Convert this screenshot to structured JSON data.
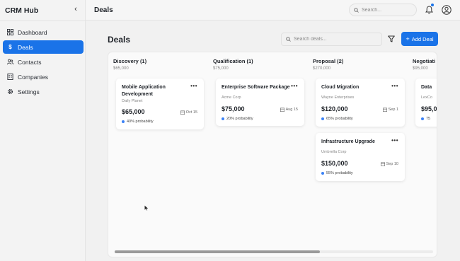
{
  "sidebar": {
    "brand": "CRM Hub",
    "collapse_icon": "‹",
    "items": [
      {
        "label": "Dashboard",
        "icon": "dashboard-icon",
        "active": false
      },
      {
        "label": "Deals",
        "icon": "dollar-icon",
        "active": true
      },
      {
        "label": "Contacts",
        "icon": "contacts-icon",
        "active": false
      },
      {
        "label": "Companies",
        "icon": "building-icon",
        "active": false
      },
      {
        "label": "Settings",
        "icon": "gear-icon",
        "active": false
      }
    ]
  },
  "topbar": {
    "title": "Deals",
    "search_placeholder": "Search..."
  },
  "main": {
    "heading": "Deals",
    "search_placeholder": "Search deals...",
    "add_button": "Add Deal"
  },
  "columns": [
    {
      "title": "Discovery (1)",
      "total": "$65,000"
    },
    {
      "title": "Qualification (1)",
      "total": "$75,000"
    },
    {
      "title": "Proposal (2)",
      "total": "$270,000"
    },
    {
      "title": "Negotiati",
      "total": "$95,000"
    }
  ],
  "cards": [
    {
      "title_line1": "Mobile Application",
      "title_line2": "Development",
      "company": "Daily Planet",
      "value": "$65,000",
      "date": "Oct 15",
      "probability": "40% probability"
    },
    {
      "title_line1": "Enterprise Software Package",
      "title_line2": "",
      "company": "Acme Corp",
      "value": "$75,000",
      "date": "Aug 15",
      "probability": "20% probability"
    },
    {
      "title_line1": "Cloud Migration",
      "title_line2": "",
      "company": "Wayne Enterprises",
      "value": "$120,000",
      "date": "Sep 1",
      "probability": "65% probability"
    },
    {
      "title_line1": "Infrastructure Upgrade",
      "title_line2": "",
      "company": "Umbrella Corp",
      "value": "$150,000",
      "date": "Sep 10",
      "probability": "55% probability"
    },
    {
      "title_line1": "Data",
      "title_line2": "",
      "company": "LexCo",
      "value": "$95,0",
      "date": "",
      "probability": "75"
    }
  ],
  "colors": {
    "accent": "#1a73e8",
    "probability_dot": "#3b82f6"
  }
}
